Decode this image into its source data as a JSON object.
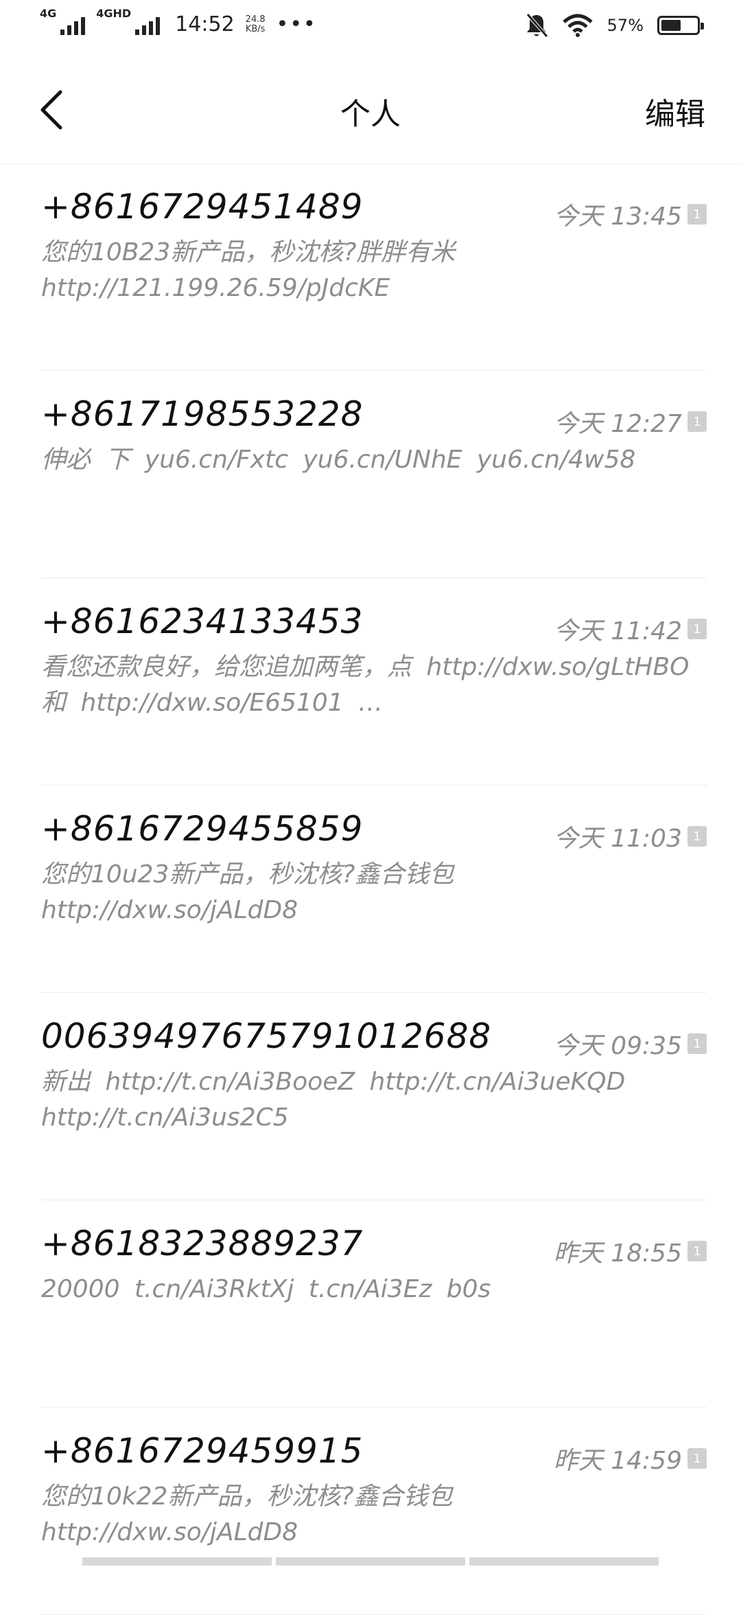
{
  "status_bar": {
    "network1": "4G",
    "network2": "4GHD",
    "time": "14:52",
    "speed_value": "24.8",
    "speed_unit": "KB/s",
    "more": "•••",
    "battery_percent": "57%",
    "battery_level": 0.57
  },
  "header": {
    "title": "个人",
    "edit_label": "编辑"
  },
  "messages": [
    {
      "sender": "+8616729451489",
      "time": "今天 13:45",
      "sim": "1",
      "preview": "您的10B23新产品，秒沈核?胖胖有米 http://121.199.26.59/pJdcKE"
    },
    {
      "sender": "+8617198553228",
      "time": "今天 12:27",
      "sim": "1",
      "preview": "伸必 下 yu6.cn/Fxtc yu6.cn/UNhE yu6.cn/4w58"
    },
    {
      "sender": "+8616234133453",
      "time": "今天 11:42",
      "sim": "1",
      "preview": "看您还款良好，给您追加两笔，点 http://dxw.so/gLtHBO 和 http://dxw.so/E65101 …"
    },
    {
      "sender": "+8616729455859",
      "time": "今天 11:03",
      "sim": "1",
      "preview": "您的10u23新产品，秒沈核?鑫合钱包 http://dxw.so/jALdD8"
    },
    {
      "sender": "00639497675791012688",
      "time": "今天 09:35",
      "sim": "1",
      "preview": "新出 http://t.cn/Ai3BooeZ http://t.cn/Ai3ueKQD http://t.cn/Ai3us2C5"
    },
    {
      "sender": "+8618323889237",
      "time": "昨天 18:55",
      "sim": "1",
      "preview": "20000 t.cn/Ai3RktXj t.cn/Ai3Ez b0s"
    },
    {
      "sender": "+8616729459915",
      "time": "昨天 14:59",
      "sim": "1",
      "preview": "您的10k22新产品，秒沈核?鑫合钱包 http://dxw.so/jALdD8"
    }
  ]
}
